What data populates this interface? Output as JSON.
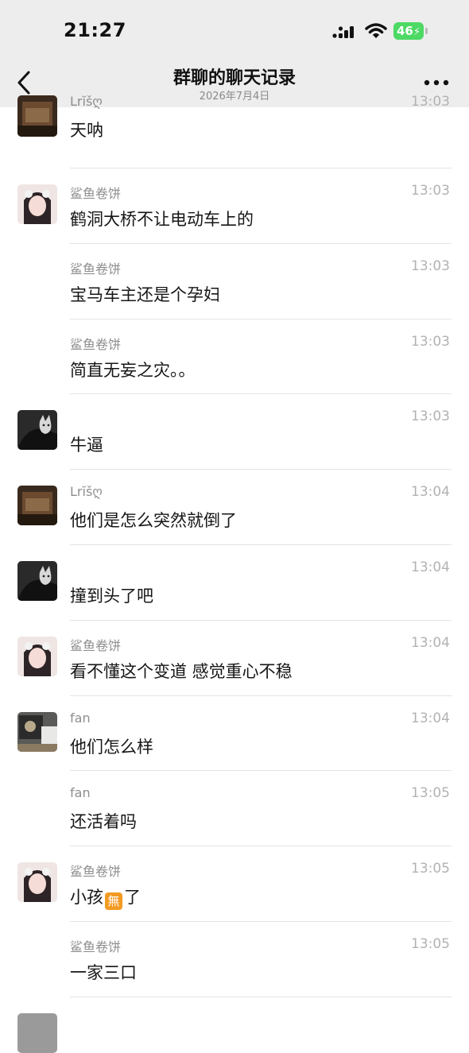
{
  "status_bar": {
    "time": "21:27",
    "battery": "46"
  },
  "header": {
    "title": "群聊的聊天记录",
    "date": "2026年7月4日"
  },
  "colors": {
    "header_bg": "#ededed",
    "battery_green": "#4cd964",
    "emoji_orange": "#f39a23"
  },
  "messages": [
    {
      "sender": "Lrĭšღ",
      "time": "13:03",
      "text": "天呐",
      "avatar": "lr"
    },
    {
      "sender": "鲨鱼卷饼",
      "time": "13:03",
      "text": "鹤洞大桥不让电动车上的",
      "avatar": "girl"
    },
    {
      "sender": "鲨鱼卷饼",
      "time": "13:03",
      "text": "宝马车主还是个孕妇",
      "avatar": ""
    },
    {
      "sender": "鲨鱼卷饼",
      "time": "13:03",
      "text": "简直无妄之灾。。",
      "avatar": ""
    },
    {
      "sender": "",
      "time": "13:03",
      "text": "牛逼",
      "avatar": "cat"
    },
    {
      "sender": "Lrĭšღ",
      "time": "13:04",
      "text": "他们是怎么突然就倒了",
      "avatar": "lr"
    },
    {
      "sender": "",
      "time": "13:04",
      "text": "撞到头了吧",
      "avatar": "cat"
    },
    {
      "sender": "鲨鱼卷饼",
      "time": "13:04",
      "text": "看不懂这个变道 感觉重心不稳",
      "avatar": "girl"
    },
    {
      "sender": "fan",
      "time": "13:04",
      "text": "他们怎么样",
      "avatar": "fan"
    },
    {
      "sender": "fan",
      "time": "13:05",
      "text": "还活着吗",
      "avatar": ""
    },
    {
      "sender": "鲨鱼卷饼",
      "time": "13:05",
      "text_before": "小孩",
      "emoji": "無",
      "text_after": "了",
      "avatar": "girl"
    },
    {
      "sender": "鲨鱼卷饼",
      "time": "13:05",
      "text": "一家三口",
      "avatar": ""
    }
  ]
}
